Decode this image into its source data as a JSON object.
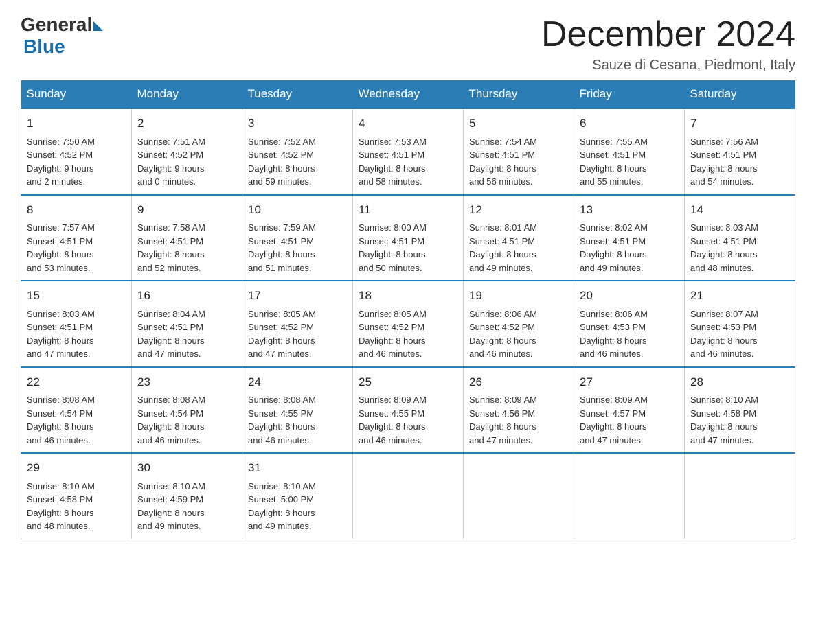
{
  "logo": {
    "general": "General",
    "blue": "Blue"
  },
  "title": "December 2024",
  "location": "Sauze di Cesana, Piedmont, Italy",
  "days_of_week": [
    "Sunday",
    "Monday",
    "Tuesday",
    "Wednesday",
    "Thursday",
    "Friday",
    "Saturday"
  ],
  "weeks": [
    [
      {
        "day": "1",
        "sunrise": "7:50 AM",
        "sunset": "4:52 PM",
        "daylight": "9 hours and 2 minutes."
      },
      {
        "day": "2",
        "sunrise": "7:51 AM",
        "sunset": "4:52 PM",
        "daylight": "9 hours and 0 minutes."
      },
      {
        "day": "3",
        "sunrise": "7:52 AM",
        "sunset": "4:52 PM",
        "daylight": "8 hours and 59 minutes."
      },
      {
        "day": "4",
        "sunrise": "7:53 AM",
        "sunset": "4:51 PM",
        "daylight": "8 hours and 58 minutes."
      },
      {
        "day": "5",
        "sunrise": "7:54 AM",
        "sunset": "4:51 PM",
        "daylight": "8 hours and 56 minutes."
      },
      {
        "day": "6",
        "sunrise": "7:55 AM",
        "sunset": "4:51 PM",
        "daylight": "8 hours and 55 minutes."
      },
      {
        "day": "7",
        "sunrise": "7:56 AM",
        "sunset": "4:51 PM",
        "daylight": "8 hours and 54 minutes."
      }
    ],
    [
      {
        "day": "8",
        "sunrise": "7:57 AM",
        "sunset": "4:51 PM",
        "daylight": "8 hours and 53 minutes."
      },
      {
        "day": "9",
        "sunrise": "7:58 AM",
        "sunset": "4:51 PM",
        "daylight": "8 hours and 52 minutes."
      },
      {
        "day": "10",
        "sunrise": "7:59 AM",
        "sunset": "4:51 PM",
        "daylight": "8 hours and 51 minutes."
      },
      {
        "day": "11",
        "sunrise": "8:00 AM",
        "sunset": "4:51 PM",
        "daylight": "8 hours and 50 minutes."
      },
      {
        "day": "12",
        "sunrise": "8:01 AM",
        "sunset": "4:51 PM",
        "daylight": "8 hours and 49 minutes."
      },
      {
        "day": "13",
        "sunrise": "8:02 AM",
        "sunset": "4:51 PM",
        "daylight": "8 hours and 49 minutes."
      },
      {
        "day": "14",
        "sunrise": "8:03 AM",
        "sunset": "4:51 PM",
        "daylight": "8 hours and 48 minutes."
      }
    ],
    [
      {
        "day": "15",
        "sunrise": "8:03 AM",
        "sunset": "4:51 PM",
        "daylight": "8 hours and 47 minutes."
      },
      {
        "day": "16",
        "sunrise": "8:04 AM",
        "sunset": "4:51 PM",
        "daylight": "8 hours and 47 minutes."
      },
      {
        "day": "17",
        "sunrise": "8:05 AM",
        "sunset": "4:52 PM",
        "daylight": "8 hours and 47 minutes."
      },
      {
        "day": "18",
        "sunrise": "8:05 AM",
        "sunset": "4:52 PM",
        "daylight": "8 hours and 46 minutes."
      },
      {
        "day": "19",
        "sunrise": "8:06 AM",
        "sunset": "4:52 PM",
        "daylight": "8 hours and 46 minutes."
      },
      {
        "day": "20",
        "sunrise": "8:06 AM",
        "sunset": "4:53 PM",
        "daylight": "8 hours and 46 minutes."
      },
      {
        "day": "21",
        "sunrise": "8:07 AM",
        "sunset": "4:53 PM",
        "daylight": "8 hours and 46 minutes."
      }
    ],
    [
      {
        "day": "22",
        "sunrise": "8:08 AM",
        "sunset": "4:54 PM",
        "daylight": "8 hours and 46 minutes."
      },
      {
        "day": "23",
        "sunrise": "8:08 AM",
        "sunset": "4:54 PM",
        "daylight": "8 hours and 46 minutes."
      },
      {
        "day": "24",
        "sunrise": "8:08 AM",
        "sunset": "4:55 PM",
        "daylight": "8 hours and 46 minutes."
      },
      {
        "day": "25",
        "sunrise": "8:09 AM",
        "sunset": "4:55 PM",
        "daylight": "8 hours and 46 minutes."
      },
      {
        "day": "26",
        "sunrise": "8:09 AM",
        "sunset": "4:56 PM",
        "daylight": "8 hours and 47 minutes."
      },
      {
        "day": "27",
        "sunrise": "8:09 AM",
        "sunset": "4:57 PM",
        "daylight": "8 hours and 47 minutes."
      },
      {
        "day": "28",
        "sunrise": "8:10 AM",
        "sunset": "4:58 PM",
        "daylight": "8 hours and 47 minutes."
      }
    ],
    [
      {
        "day": "29",
        "sunrise": "8:10 AM",
        "sunset": "4:58 PM",
        "daylight": "8 hours and 48 minutes."
      },
      {
        "day": "30",
        "sunrise": "8:10 AM",
        "sunset": "4:59 PM",
        "daylight": "8 hours and 49 minutes."
      },
      {
        "day": "31",
        "sunrise": "8:10 AM",
        "sunset": "5:00 PM",
        "daylight": "8 hours and 49 minutes."
      },
      null,
      null,
      null,
      null
    ]
  ],
  "labels": {
    "sunrise": "Sunrise:",
    "sunset": "Sunset:",
    "daylight": "Daylight:"
  }
}
